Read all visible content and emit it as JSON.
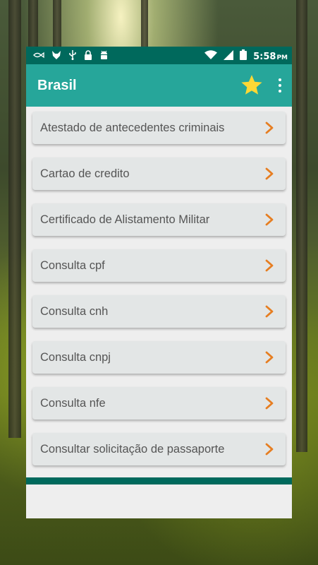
{
  "status_bar": {
    "left_icons": [
      "fish-icon",
      "fox-icon",
      "usb-icon",
      "lock-icon",
      "android-icon"
    ],
    "right_icons": [
      "wifi-icon",
      "signal-icon",
      "battery-icon"
    ],
    "time": "5:58",
    "ampm": "PM"
  },
  "app_bar": {
    "title": "Brasil",
    "favorite_icon": "star-icon",
    "star_color": "#fdd835",
    "menu_icon": "more-vert-icon"
  },
  "list": {
    "items": [
      {
        "label": "Atestado de antecedentes criminais"
      },
      {
        "label": "Cartao de credito"
      },
      {
        "label": "Certificado de Alistamento Militar"
      },
      {
        "label": "Consulta cpf"
      },
      {
        "label": "Consulta cnh"
      },
      {
        "label": "Consulta cnpj"
      },
      {
        "label": "Consulta nfe"
      },
      {
        "label": "Consultar solicitação de passaporte"
      }
    ],
    "chevron_color": "#e67e22"
  },
  "colors": {
    "primary_dark": "#00695c",
    "primary": "#26a69a"
  }
}
